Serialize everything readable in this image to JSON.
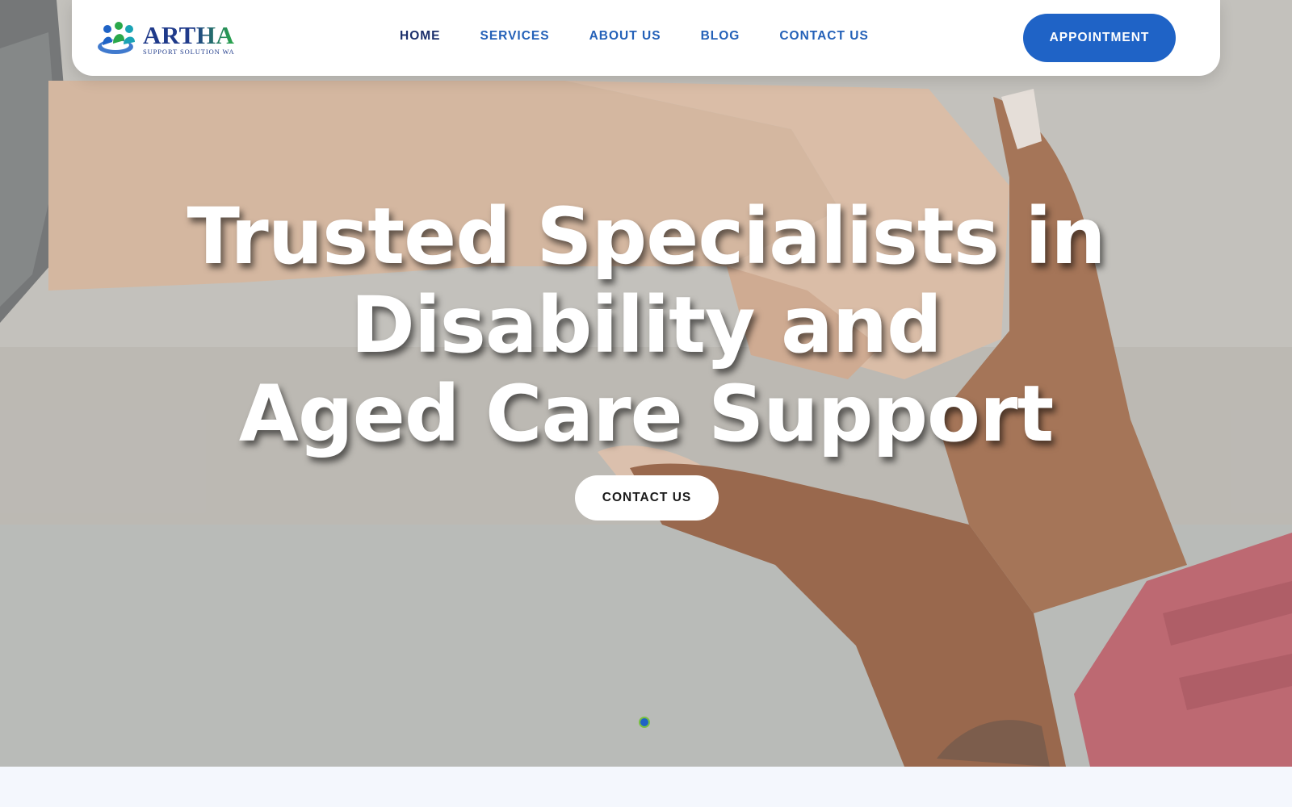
{
  "brand": {
    "name": "ARTHA",
    "tagline": "SUPPORT SOLUTION WA"
  },
  "nav": {
    "items": [
      {
        "label": "HOME"
      },
      {
        "label": "SERVICES"
      },
      {
        "label": "ABOUT US"
      },
      {
        "label": "BLOG"
      },
      {
        "label": "CONTACT US"
      }
    ],
    "active": "HOME",
    "appointment_label": "APPOINTMENT"
  },
  "hero": {
    "headline_lines": [
      "Trusted Specialists in",
      "Disability and",
      "Aged Care Support"
    ],
    "cta_label": "CONTACT US",
    "slider": {
      "slides": 1,
      "current": 1
    }
  },
  "colors": {
    "accent": "#1f63c6",
    "nav_text": "#2461b8",
    "nav_active": "#1b2f6b",
    "brand_green": "#2aa84a",
    "dot_ring": "#7ac143"
  }
}
